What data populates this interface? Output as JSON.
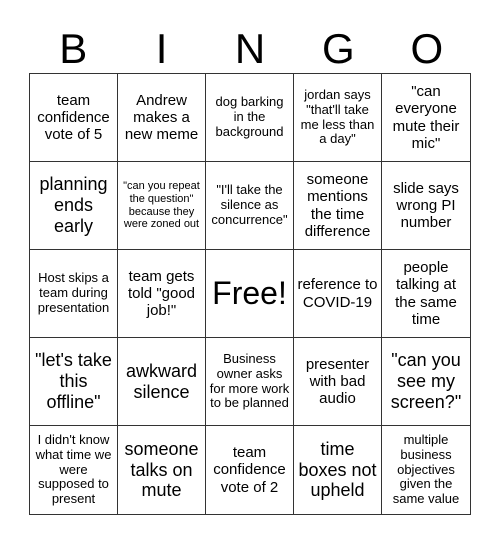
{
  "title_letters": [
    "B",
    "I",
    "N",
    "G",
    "O"
  ],
  "cells": [
    {
      "text": "team confidence vote of 5",
      "size": "s3"
    },
    {
      "text": "Andrew makes a new meme",
      "size": "s3"
    },
    {
      "text": "dog barking in the background",
      "size": "s2"
    },
    {
      "text": "jordan says \"that'll take me less than a day\"",
      "size": "s2"
    },
    {
      "text": "\"can everyone mute their mic\"",
      "size": "s3"
    },
    {
      "text": "planning ends early",
      "size": "s4"
    },
    {
      "text": "\"can you repeat the question\" because they were zoned out",
      "size": "s1"
    },
    {
      "text": "\"I'll take the silence as concurrence\"",
      "size": "s2"
    },
    {
      "text": "someone mentions the time difference",
      "size": "s3"
    },
    {
      "text": "slide says wrong PI number",
      "size": "s3"
    },
    {
      "text": "Host skips a team during presentation",
      "size": "s2"
    },
    {
      "text": "team gets told \"good job!\"",
      "size": "s3"
    },
    {
      "text": "Free!",
      "size": "s5"
    },
    {
      "text": "reference to COVID-19",
      "size": "s3"
    },
    {
      "text": "people talking at the same time",
      "size": "s3"
    },
    {
      "text": "\"let's take this offline\"",
      "size": "s4"
    },
    {
      "text": "awkward silence",
      "size": "s4"
    },
    {
      "text": "Business owner asks for more work to be planned",
      "size": "s2"
    },
    {
      "text": "presenter with bad audio",
      "size": "s3"
    },
    {
      "text": "\"can you see my screen?\"",
      "size": "s4"
    },
    {
      "text": "I didn't know what time we were supposed to present",
      "size": "s2"
    },
    {
      "text": "someone talks on mute",
      "size": "s4"
    },
    {
      "text": "team confidence vote of 2",
      "size": "s3"
    },
    {
      "text": "time boxes not upheld",
      "size": "s4"
    },
    {
      "text": "multiple business objectives given the same value",
      "size": "s2"
    }
  ]
}
